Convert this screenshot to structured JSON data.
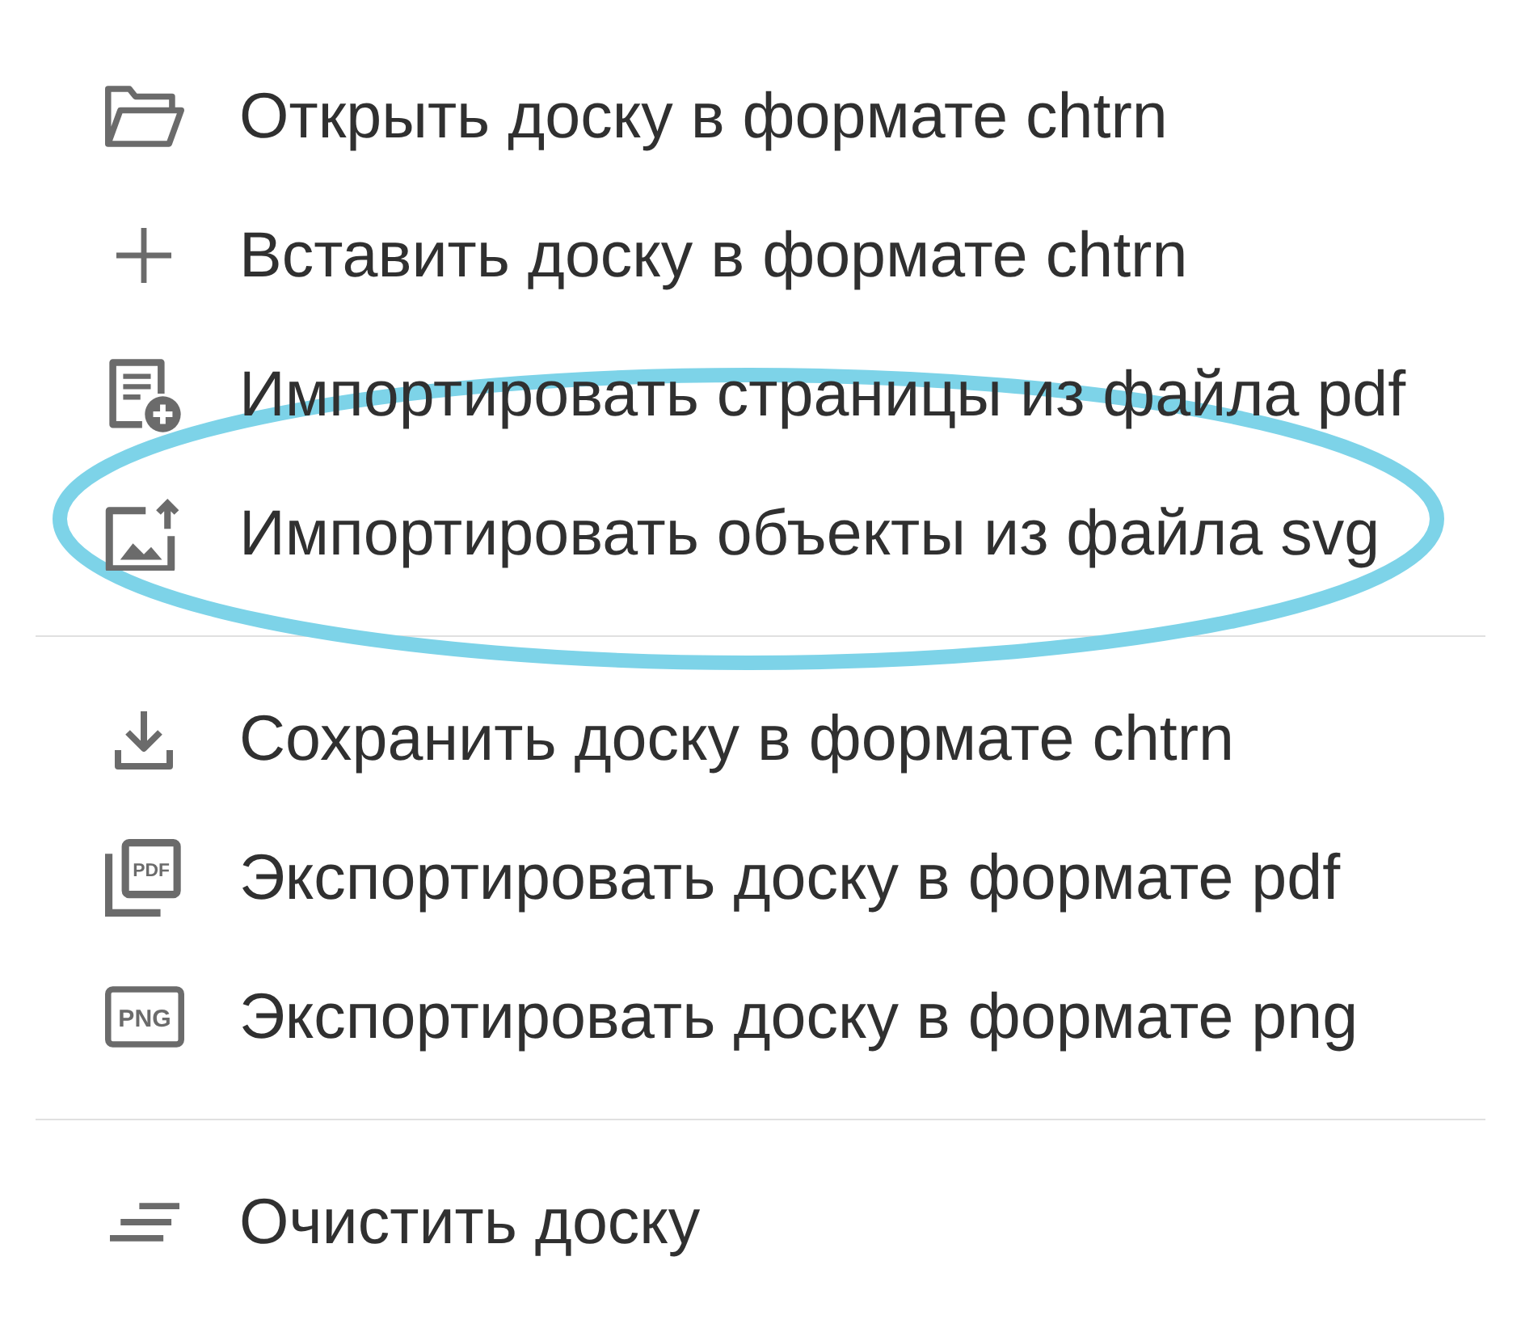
{
  "menu": {
    "groups": [
      {
        "items": [
          {
            "label": "Открыть доску в формате chtrn",
            "circled": false
          },
          {
            "label": "Вставить доску в формате chtrn",
            "circled": false
          },
          {
            "label": "Импортировать страницы из файла pdf",
            "circled": false
          },
          {
            "label": "Импортировать объекты из файла svg",
            "circled": true
          }
        ]
      },
      {
        "items": [
          {
            "label": "Сохранить доску в формате chtrn",
            "circled": false
          },
          {
            "label": "Экспортировать доску в формате pdf",
            "icon_text": "PDF",
            "circled": false
          },
          {
            "label": "Экспортировать доску в формате png",
            "icon_text": "PNG",
            "circled": false
          }
        ]
      },
      {
        "items": [
          {
            "label": "Очистить доску",
            "circled": false
          }
        ]
      }
    ]
  }
}
